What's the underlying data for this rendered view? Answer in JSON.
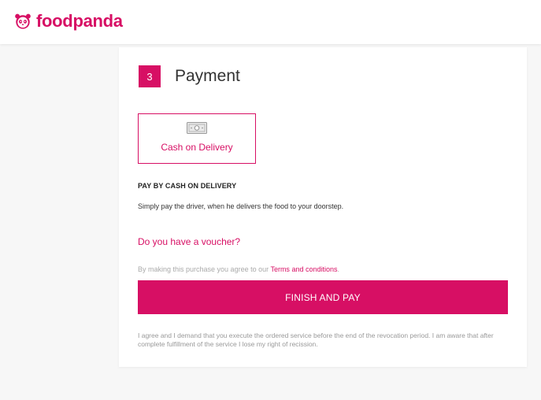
{
  "header": {
    "brand_name": "foodpanda",
    "brand_color": "#d70f64",
    "logo_icon": "panda-face-icon"
  },
  "payment": {
    "step_number": "3",
    "title": "Payment",
    "option": {
      "icon": "cash-icon",
      "label": "Cash on Delivery"
    },
    "section_heading": "PAY BY CASH ON DELIVERY",
    "section_description": "Simply pay the driver, when he delivers the food to your doorstep.",
    "voucher_link": "Do you have a voucher?",
    "terms_prefix": "By making this purchase you agree to our ",
    "terms_link": "Terms and conditions",
    "terms_suffix": ".",
    "finish_button": "FINISH AND PAY",
    "disclaimer": "I agree and I demand that you execute the ordered service before the end of the revocation period. I am aware that after complete fulfillment of the service I lose my right of recission."
  }
}
